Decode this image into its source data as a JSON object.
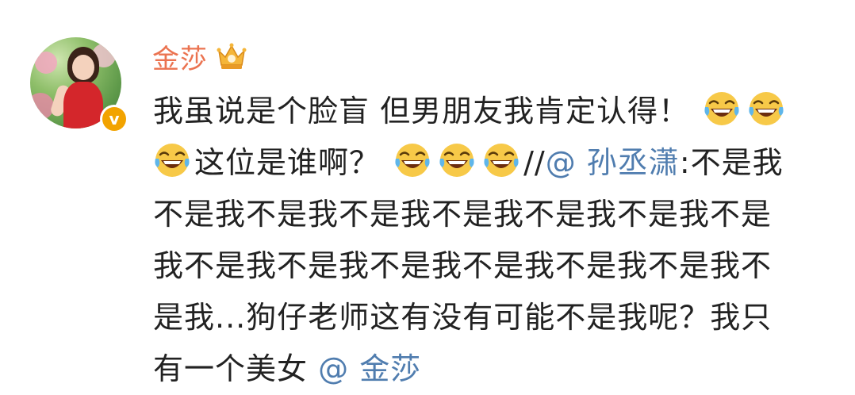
{
  "post": {
    "author": {
      "name": "金莎",
      "badge_icon": "crown-icon",
      "verified_icon": "verified-v-icon",
      "verified_label": "v"
    },
    "lines": [
      {
        "t1": "我虽说是个脸盲 但男朋友我肯定认得！"
      },
      {
        "t1": "这位是谁啊？",
        "t2": "//",
        "mention": "@ 孙丞潇",
        "t3": ":不是我"
      },
      {
        "t1": "不是我不是我不是我不是我不是我不是我不是"
      },
      {
        "t1": "我不是我不是我不是我不是我不是我不是我不"
      },
      {
        "t1": "是我...狗仔老师这有没有可能不是我呢？我只"
      },
      {
        "t1": "有一个美女",
        "mention": "@ 金莎"
      }
    ],
    "emoji_name": "laugh-cry-emoji",
    "colors": {
      "username": "#eb7350",
      "mention": "#507daf",
      "text": "#222222",
      "verified": "#f2a300"
    }
  }
}
